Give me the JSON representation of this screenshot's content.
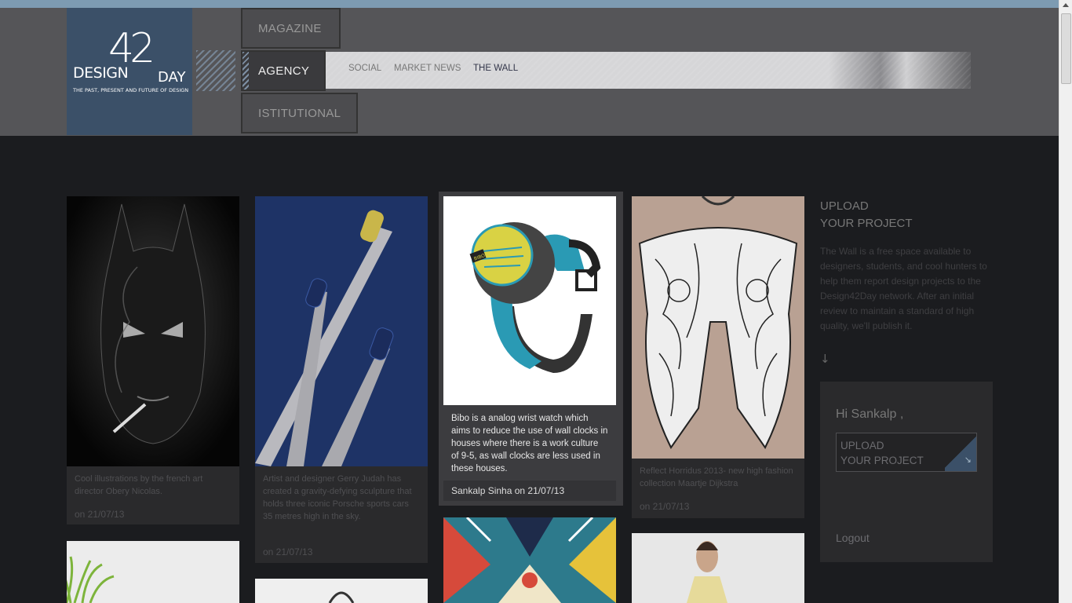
{
  "logo": {
    "design": "DESIGN",
    "number": "42",
    "day": "DAY",
    "tagline": "THE PAST, PRESENT AND FUTURE OF DESIGN"
  },
  "nav": {
    "magazine": "MAGAZINE",
    "agency": "AGENCY",
    "istitutional": "ISTITUTIONAL"
  },
  "subnav": {
    "social": "SOCIAL",
    "market_news": "MARKET NEWS",
    "the_wall": "THE WALL"
  },
  "cards": [
    {
      "caption": "Cool illustrations by the french art director Obery Nicolas.",
      "date": "on 21/07/13"
    },
    {
      "caption": "Artist and designer Gerry Judah has created a gravity-defying sculpture that holds three iconic Porsche sports cars 35 metres high in the sky.",
      "date": "on 21/07/13"
    },
    {
      "caption": "Reflect Horridus 2013- new high fashion collection Maartje Dijkstra",
      "date": "on 21/07/13"
    }
  ],
  "featured": {
    "caption": "Bibo is a analog wrist watch which aims to reduce the use of wall clocks in houses where there is a work culture of 9-5, as wall clocks are less used in these houses.",
    "author": "Sankalp Sinha on 21/07/13",
    "watch_label": "BIBO"
  },
  "sidebar": {
    "title_line1": "UPLOAD",
    "title_line2": "YOUR PROJECT",
    "description": "The Wall is a free space available to designers, students, and cool hunters to help them report design projects to the Design42Day network. After an initial review to maintain a standard of high quality, we'll publish it.",
    "arrow": "↓",
    "greeting": "Hi Sankalp ,",
    "upload_line1": "UPLOAD",
    "upload_line2": "YOUR PROJECT",
    "upload_arrow": "↘",
    "logout": "Logout"
  },
  "colors": {
    "logo_bg": "#3b5068",
    "header_bg": "#555558",
    "page_bg": "#1b1c1f",
    "top_strip": "#7d9bb2"
  }
}
